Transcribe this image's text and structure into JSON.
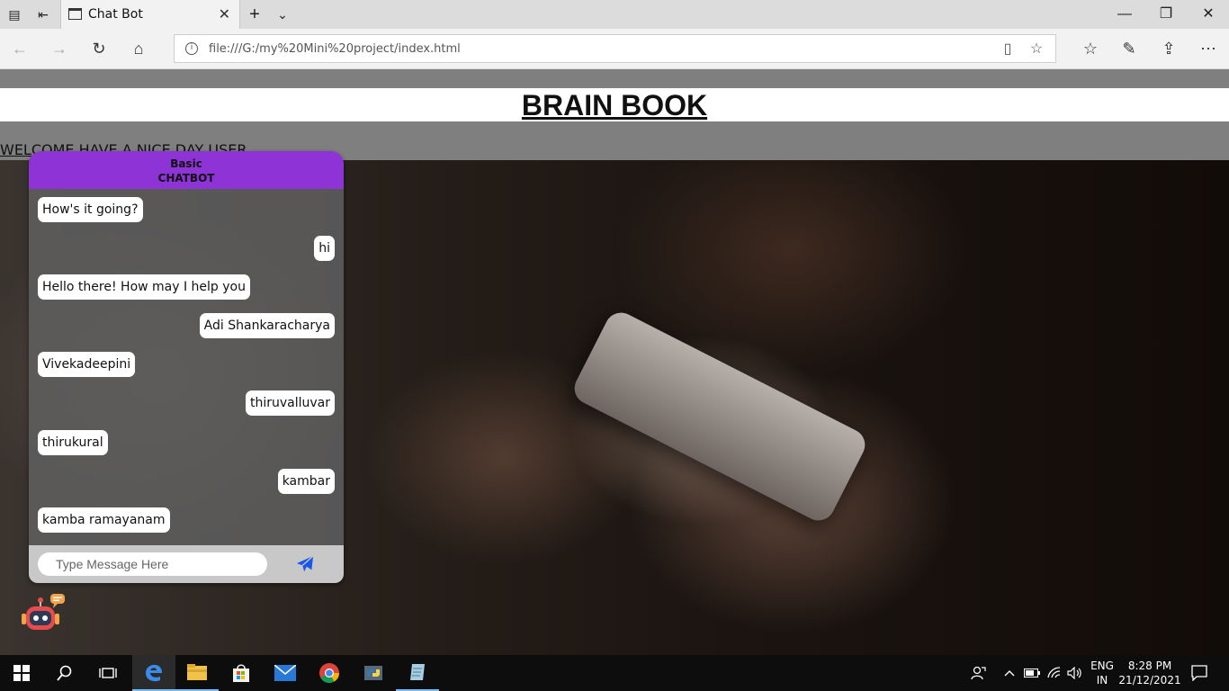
{
  "browser": {
    "tab_title": "Chat Bot",
    "address": "file:///G:/my%20Mini%20project/index.html"
  },
  "page": {
    "title": "BRAIN BOOK",
    "welcome": "WELCOME HAVE A NICE DAY USER"
  },
  "chatbot": {
    "header_line1": "Basic",
    "header_line2": "CHATBOT",
    "messages": [
      {
        "from": "bot",
        "text": "How's it going?"
      },
      {
        "from": "user",
        "text": "hi"
      },
      {
        "from": "bot",
        "text": "Hello there! How may I help you"
      },
      {
        "from": "user",
        "text": "Adi Shankaracharya"
      },
      {
        "from": "bot",
        "text": "Vivekadeepini"
      },
      {
        "from": "user",
        "text": "thiruvalluvar"
      },
      {
        "from": "bot",
        "text": "thirukural"
      },
      {
        "from": "user",
        "text": "kambar"
      },
      {
        "from": "bot",
        "text": "kamba ramayanam"
      }
    ],
    "input_placeholder": "Type Message Here",
    "header_color": "#8e33d6",
    "send_color": "#1a56e8"
  },
  "taskbar": {
    "language_line1": "ENG",
    "language_line2": "IN",
    "time": "8:28 PM",
    "date": "21/12/2021"
  }
}
